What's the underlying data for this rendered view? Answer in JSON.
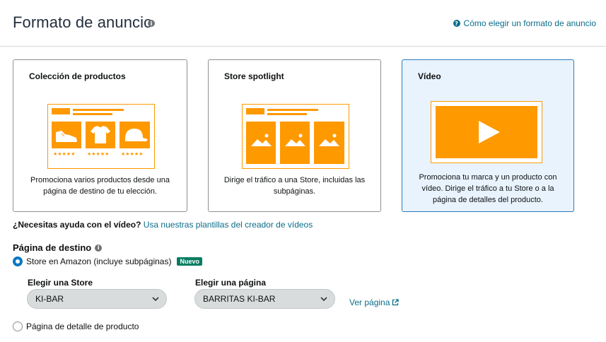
{
  "header": {
    "title": "Formato de anuncio",
    "help_link": "Cómo elegir un formato de anuncio"
  },
  "colors": {
    "accent_orange": "#ff9900",
    "link": "#0a6e8a",
    "selected_bg": "#e8f3fe",
    "selected_border": "#2a7ab9",
    "badge_green": "#067d62"
  },
  "cards": [
    {
      "title": "Colección de productos",
      "description": "Promociona varios productos desde una página de destino de tu elección.",
      "icon": "product-collection-illustration",
      "selected": false
    },
    {
      "title": "Store spotlight",
      "description": "Dirige el tráfico a una Store, incluidas las subpáginas.",
      "icon": "store-spotlight-illustration",
      "selected": false
    },
    {
      "title": "Vídeo",
      "description": "Promociona tu marca y un producto con vídeo. Dirige el tráfico a tu Store o a la página de detalles del producto.",
      "icon": "video-play-illustration",
      "selected": true
    }
  ],
  "video_help": {
    "question": "¿Necesitas ayuda con el vídeo?",
    "link": "Usa nuestras plantillas del creador de vídeos"
  },
  "landing": {
    "label": "Página de destino",
    "option_store": {
      "label": "Store en Amazon (incluye subpáginas)",
      "badge": "Nuevo",
      "selected": true
    },
    "store_select": {
      "label": "Elegir una Store",
      "value": "KI-BAR"
    },
    "page_select": {
      "label": "Elegir una página",
      "value": "BARRITAS KI-BAR"
    },
    "view_link": "Ver página",
    "option_product": {
      "label": "Página de detalle de producto",
      "selected": false
    }
  }
}
